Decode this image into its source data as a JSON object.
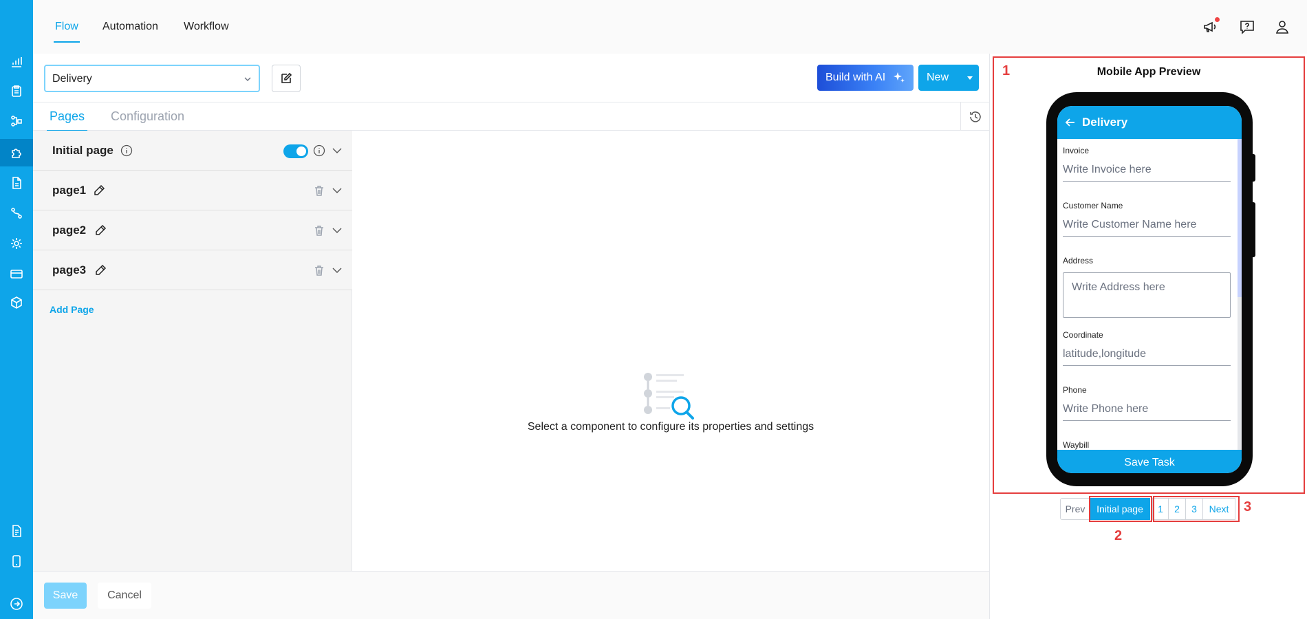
{
  "topnav": {
    "tabs": [
      {
        "label": "Flow",
        "active": true
      },
      {
        "label": "Automation",
        "active": false
      },
      {
        "label": "Workflow",
        "active": false
      }
    ],
    "icons": [
      "megaphone-icon",
      "help-chat-icon",
      "user-icon"
    ]
  },
  "rail": {
    "icons": [
      "chart-icon",
      "clipboard-icon",
      "flow-icon",
      "puzzle-icon",
      "document-icon",
      "route-icon",
      "gear-icon",
      "card-icon",
      "box-icon",
      "file-icon",
      "mobile-icon",
      "logout-icon"
    ],
    "active": "puzzle-icon"
  },
  "toolbar": {
    "flow_select": "Delivery",
    "build_ai_label": "Build with AI",
    "new_label": "New"
  },
  "subtabs": {
    "pages": "Pages",
    "configuration": "Configuration"
  },
  "pages": [
    {
      "name": "Initial page",
      "toggle_on": true
    },
    {
      "name": "page1"
    },
    {
      "name": "page2"
    },
    {
      "name": "page3"
    }
  ],
  "add_page_label": "Add Page",
  "canvas": {
    "empty_text": "Select a component to configure its properties and settings"
  },
  "footer": {
    "save_label": "Save",
    "cancel_label": "Cancel"
  },
  "preview": {
    "title": "Mobile App Preview",
    "app_title": "Delivery",
    "fields": [
      {
        "label": "Invoice",
        "placeholder": "Write Invoice here"
      },
      {
        "label": "Customer Name",
        "placeholder": "Write Customer Name here"
      },
      {
        "label": "Address",
        "placeholder": "Write Address here"
      },
      {
        "label": "Coordinate",
        "placeholder": "latitude,longitude"
      },
      {
        "label": "Phone",
        "placeholder": "Write Phone here"
      },
      {
        "label": "Waybill",
        "placeholder": ""
      }
    ],
    "save_task_label": "Save Task",
    "pager": {
      "prev": "Prev",
      "initial": "Initial page",
      "pages": [
        "1",
        "2",
        "3"
      ],
      "next": "Next"
    },
    "annotations": [
      "1",
      "2",
      "3"
    ],
    "annotation_color": "#e53e3e"
  },
  "colors": {
    "accent": "#0ea5e9",
    "rail": "#0ea5e9"
  }
}
